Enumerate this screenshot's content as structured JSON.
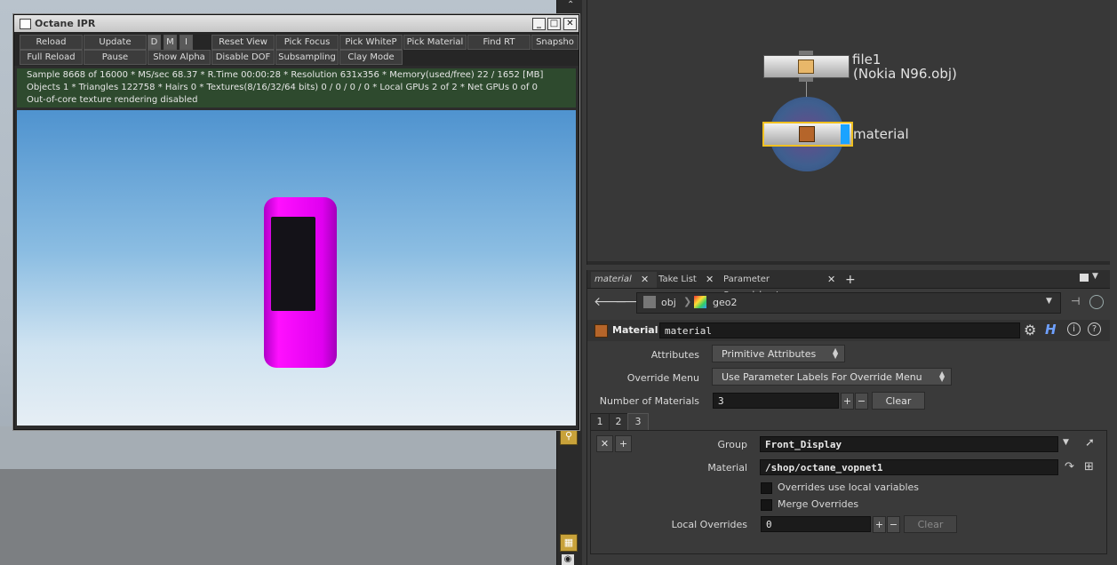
{
  "ipr": {
    "title": "Octane IPR",
    "toolbar_row1": [
      "Reload",
      "Update",
      "D",
      "M",
      "I",
      "Reset View",
      "Pick Focus",
      "Pick WhiteP",
      "Pick Material",
      "Find RT",
      "Snapsho"
    ],
    "toolbar_row2": [
      "Full Reload",
      "Pause",
      "Show Alpha",
      "Disable DOF",
      "Subsampling",
      "Clay Mode"
    ],
    "status_lines": [
      "Sample 8668 of 16000 * MS/sec 68.37 * R.Time 00:00:28 * Resolution 631x356 * Memory(used/free) 22 / 1652 [MB]",
      "Objects 1 * Triangles 122758 * Hairs 0 * Textures(8/16/32/64 bits) 0 / 0 / 0 / 0 * Local GPUs 2 of 2 * Net GPUs 0 of 0",
      "Out-of-core texture rendering disabled"
    ]
  },
  "network": {
    "nodes": [
      {
        "name": "file1",
        "subtitle": "(Nokia N96.obj)"
      },
      {
        "name": "material"
      }
    ]
  },
  "params": {
    "tabs": [
      "material",
      "Take List",
      "Parameter Spreadsheet"
    ],
    "path": [
      "obj",
      "geo2"
    ],
    "node_type": "Material",
    "node_name": "material",
    "attributes_label": "Attributes",
    "attributes_value": "Primitive Attributes",
    "override_menu_label": "Override Menu",
    "override_menu_value": "Use Parameter Labels For Override Menu",
    "num_materials_label": "Number of Materials",
    "num_materials_value": "3",
    "clear_label": "Clear",
    "mat_tabs": [
      "1",
      "2",
      "3"
    ],
    "group_label": "Group",
    "group_value": "Front_Display",
    "material_label": "Material",
    "material_value": "/shop/octane_vopnet1",
    "overrides_local_label": "Overrides use local variables",
    "merge_overrides_label": "Merge Overrides",
    "local_overrides_label": "Local Overrides",
    "local_overrides_value": "0",
    "clear2_label": "Clear"
  }
}
